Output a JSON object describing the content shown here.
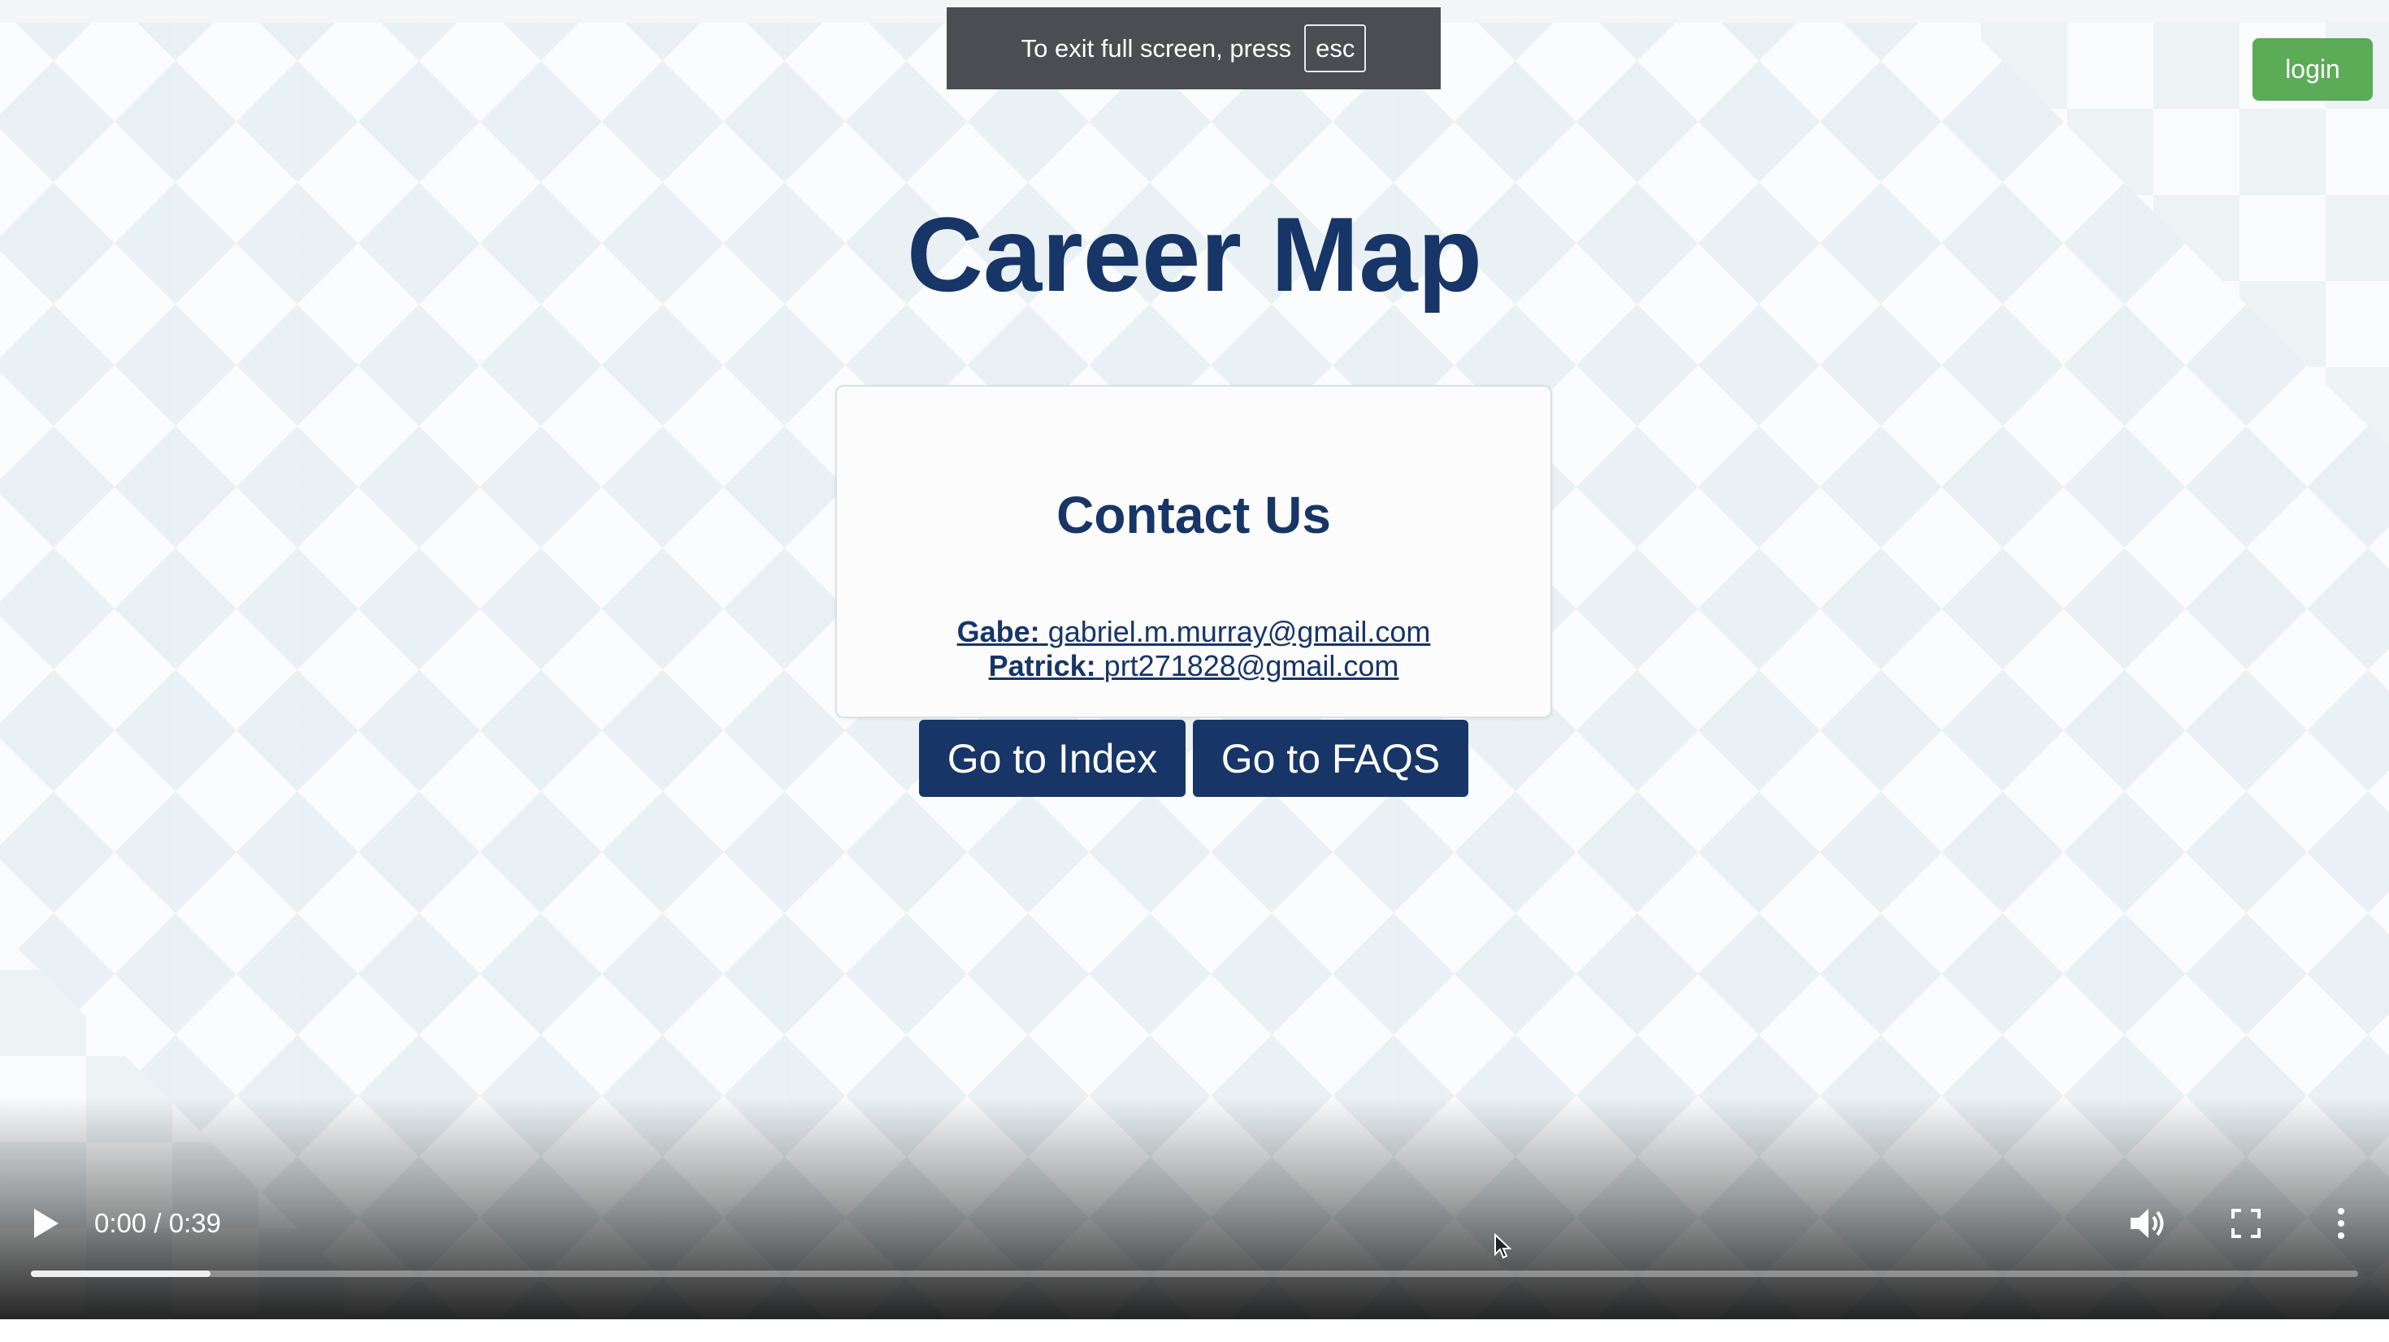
{
  "fullscreen_notice": {
    "message": "To exit full screen, press",
    "key": "esc"
  },
  "header": {
    "login_label": "login"
  },
  "page": {
    "title": "Career Map"
  },
  "contact": {
    "heading": "Contact Us",
    "entries": [
      {
        "name": "Gabe:",
        "email": "gabriel.m.murray@gmail.com"
      },
      {
        "name": "Patrick:",
        "email": "prt271828@gmail.com"
      }
    ]
  },
  "nav": {
    "index_label": "Go to Index",
    "faqs_label": "Go to FAQS"
  },
  "video_controls": {
    "time": "0:00 / 0:39",
    "buffered_fraction": 0.077,
    "icons": {
      "play": "play-icon",
      "volume": "volume-icon",
      "fullscreen": "fullscreen-icon",
      "more": "more-options-icon"
    }
  },
  "colors": {
    "brand_navy": "#173566",
    "login_green": "#5bab57",
    "toast_bg": "#4b4d52"
  }
}
